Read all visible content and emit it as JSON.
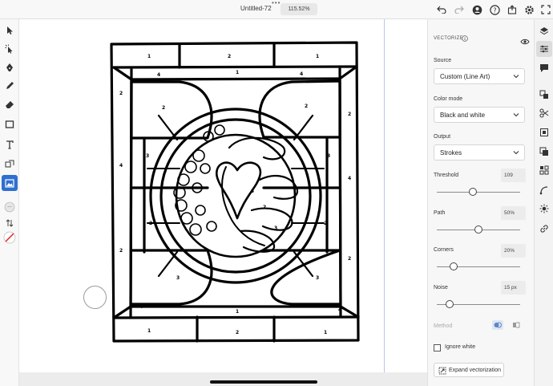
{
  "document": {
    "title": "Untitled-72",
    "zoom": "115.52%"
  },
  "topbar_icons": [
    "undo-icon",
    "redo-icon",
    "user-share-icon",
    "help-icon",
    "export-icon",
    "settings-icon",
    "fullscreen-icon"
  ],
  "left_tools": [
    "select-tool-icon",
    "direct-select-icon",
    "pen-tool-icon",
    "pencil-tool-icon",
    "eraser-tool-icon",
    "rectangle-tool-icon",
    "type-tool-icon",
    "shape-builder-icon",
    "image-tool-icon",
    "more-tools-icon",
    "swap-colors-icon",
    "fill-stroke-icon"
  ],
  "vectorize": {
    "heading": "VECTORIZE",
    "source": {
      "label": "Source",
      "value": "Custom (Line Art)"
    },
    "color_mode": {
      "label": "Color mode",
      "value": "Black and white"
    },
    "output": {
      "label": "Output",
      "value": "Strokes"
    },
    "threshold": {
      "label": "Threshold",
      "value": "109",
      "fraction": 0.43
    },
    "path": {
      "label": "Path",
      "value": "50%",
      "fraction": 0.5
    },
    "corners": {
      "label": "Corners",
      "value": "20%",
      "fraction": 0.2
    },
    "noise": {
      "label": "Noise",
      "value": "15 px",
      "fraction": 0.15
    },
    "method": {
      "label": "Method"
    },
    "ignore_white": {
      "label": "Ignore white",
      "checked": false
    },
    "expand_button": "Expand vectorization"
  },
  "rail_icons": [
    "layers-icon",
    "properties-icon",
    "comments-icon",
    "align-icon",
    "scissors-icon",
    "transform-icon",
    "pathfinder-icon",
    "repeat-icon",
    "warp-icon",
    "effects-icon",
    "link-icon"
  ],
  "colors": {
    "accent": "#2f6fcf",
    "stroke_swatch": "#d22"
  }
}
